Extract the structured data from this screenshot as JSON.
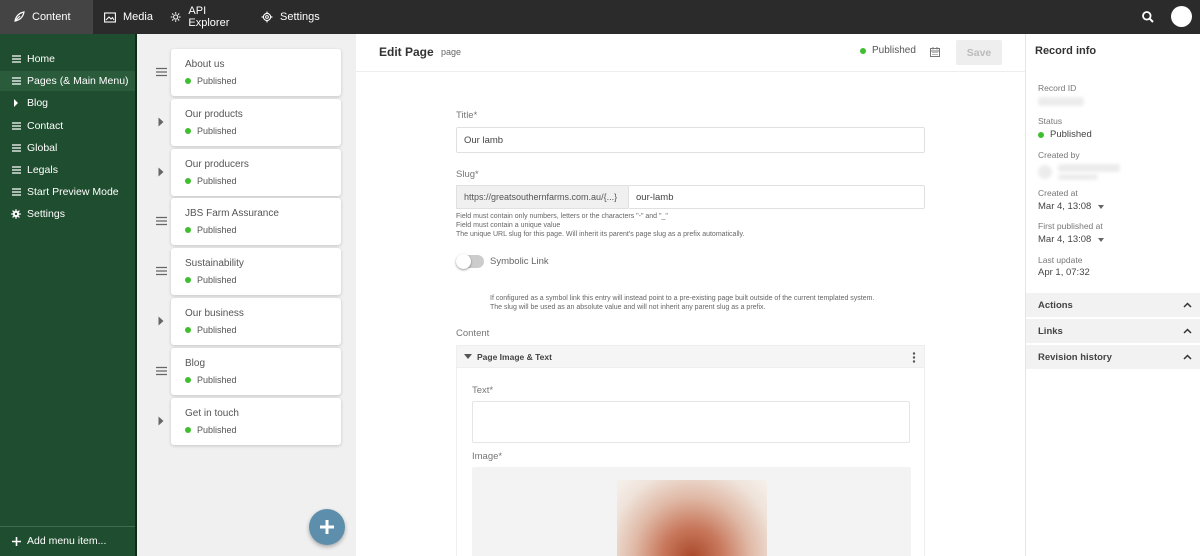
{
  "topbar": {
    "nav": [
      {
        "label": "Content",
        "icon": "feather-icon",
        "active": true
      },
      {
        "label": "Media",
        "icon": "image-icon"
      },
      {
        "label": "API Explorer",
        "icon": "cog-icon"
      },
      {
        "label": "Settings",
        "icon": "gear-icon"
      }
    ],
    "search_icon": "search-icon",
    "avatar_icon": "user-avatar"
  },
  "sidebar": {
    "items": [
      {
        "label": "Home",
        "icon": "menu-lines-icon"
      },
      {
        "label": "Pages (& Main Menu)",
        "icon": "menu-lines-icon",
        "active": true
      },
      {
        "label": "Blog",
        "icon": "caret-right-icon"
      },
      {
        "label": "Contact",
        "icon": "menu-lines-icon"
      },
      {
        "label": "Global",
        "icon": "menu-lines-icon"
      },
      {
        "label": "Legals",
        "icon": "menu-lines-icon"
      },
      {
        "label": "Start Preview Mode",
        "icon": "menu-lines-icon"
      },
      {
        "label": "Settings",
        "icon": "gear-icon"
      }
    ],
    "add_label": "Add menu item..."
  },
  "pages": [
    {
      "title": "About us",
      "status": "Published",
      "handle": "drag"
    },
    {
      "title": "Our products",
      "status": "Published",
      "handle": "expand"
    },
    {
      "title": "Our producers",
      "status": "Published",
      "handle": "expand"
    },
    {
      "title": "JBS Farm Assurance",
      "status": "Published",
      "handle": "drag"
    },
    {
      "title": "Sustainability",
      "status": "Published",
      "handle": "drag"
    },
    {
      "title": "Our business",
      "status": "Published",
      "handle": "expand"
    },
    {
      "title": "Blog",
      "status": "Published",
      "handle": "drag"
    },
    {
      "title": "Get in touch",
      "status": "Published",
      "handle": "expand"
    }
  ],
  "editor": {
    "title": "Edit Page",
    "subtitle": "page",
    "status": "Published",
    "save_label": "Save",
    "fields": {
      "title_label": "Title*",
      "title_value": "Our lamb",
      "slug_label": "Slug*",
      "slug_prefix": "https://greatsouthernfarms.com.au/{...}",
      "slug_value": "our-lamb",
      "slug_help": [
        "Field must contain only numbers, letters or the characters \"-\" and \"_\"",
        "Field must contain a unique value",
        "The unique URL slug for this page. Will inherit its parent's page slug as a prefix automatically."
      ],
      "symbolic_label": "Symbolic Link",
      "symbolic_enabled": false,
      "symbolic_help": [
        "If configured as a symbol link this entry will instead point to a pre-existing page built outside of the current templated system.",
        "The slug will be used as an absolute value and will not inherit any parent slug as a prefix."
      ],
      "content_label": "Content",
      "block_title": "Page Image & Text",
      "text_label": "Text*",
      "image_label": "Image*"
    }
  },
  "record": {
    "title": "Record info",
    "record_id_label": "Record ID",
    "status_label": "Status",
    "status_value": "Published",
    "created_by_label": "Created by",
    "created_at_label": "Created at",
    "created_at_value": "Mar 4, 13:08",
    "first_published_label": "First published at",
    "first_published_value": "Mar 4, 13:08",
    "last_update_label": "Last update",
    "last_update_value": "Apr 1, 07:32",
    "sections": [
      "Actions",
      "Links",
      "Revision history"
    ]
  },
  "colors": {
    "topbar": "#2b2b2b",
    "sidebar": "#1f4d2f",
    "status_green": "#3fbf2f",
    "fab": "#5d8fad"
  }
}
